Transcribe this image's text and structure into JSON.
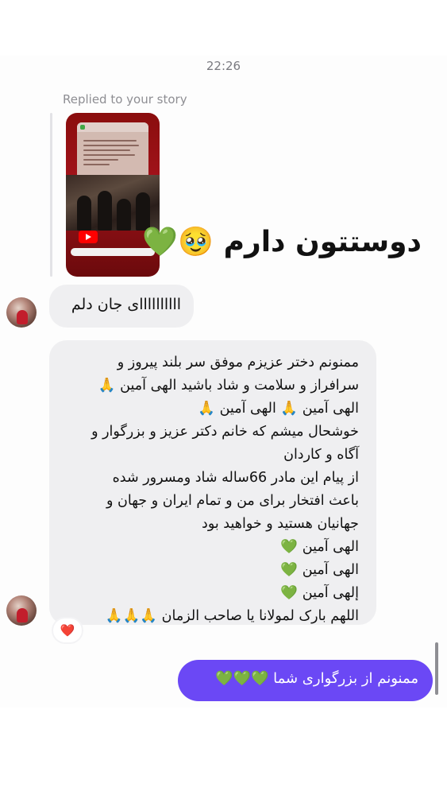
{
  "timestamp": "22:26",
  "reply_label": "Replied to your story",
  "story_reply_text": "دوستتون دارم 🥹💚",
  "messages_in": [
    "اااااااااای جان دلم",
    {
      "lines": [
        "ممنونم دختر عزیزم موفق سر بلند پیروز و",
        "سرافراز و سلامت و شاد باشید الهی آمین 🙏",
        "الهی آمین 🙏 الهی آمین 🙏",
        "خوشحال میشم که خانم  دکتر عزیز و بزرگوار و",
        "آگاه و کاردان",
        "از پیام این مادر 66ساله  شاد ومسرور شده",
        "باعث افتخار برای من و تمام ایران و جهان و",
        "جهانیان هستید و خواهید بود",
        "الهی آمین 💚",
        "الهی آمین 💚",
        "إلهی آمین 💚",
        "اللهم بارک لمولانا یا صاحب الزمان 🙏🙏🙏"
      ],
      "reaction": "❤️"
    }
  ],
  "message_out": "ممنونم از بزرگواری شما 💚💚💚",
  "colors": {
    "outgoing_bubble": "#6b48f5",
    "incoming_bubble": "#efeff1",
    "story_bg": "#a1131a"
  },
  "icons": {
    "story_app": "youtube-icon",
    "reaction": "heart-icon"
  }
}
